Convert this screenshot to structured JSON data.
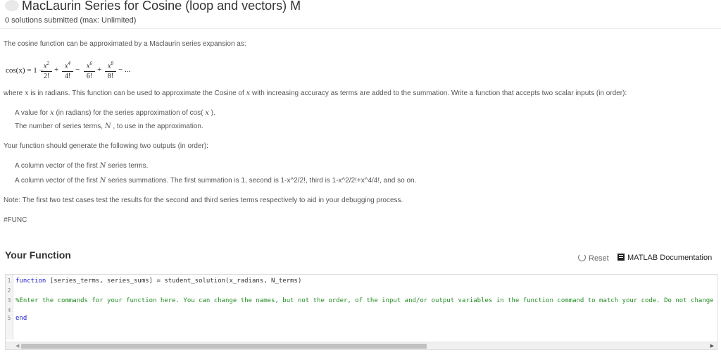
{
  "header": {
    "title": "MacLaurin Series for Cosine (loop and vectors) M",
    "subtitle": "0 solutions submitted (max: Unlimited)"
  },
  "description": {
    "intro": "The cosine function can be approximated by a Maclaurin series expansion as:",
    "formula": {
      "lhs": "cos(x) = 1 −",
      "terms": [
        {
          "num_base": "x",
          "num_exp": "2",
          "den": "2!",
          "op_after": "+"
        },
        {
          "num_base": "x",
          "num_exp": "4",
          "den": "4!",
          "op_after": "−"
        },
        {
          "num_base": "x",
          "num_exp": "6",
          "den": "6!",
          "op_after": "+"
        },
        {
          "num_base": "x",
          "num_exp": "8",
          "den": "8!",
          "op_after": "− ..."
        }
      ]
    },
    "where_pre": "where ",
    "where_var1": "x",
    "where_mid": " is in radians. This function can be used to approximate the Cosine of ",
    "where_var2": "x",
    "where_post": " with increasing accuracy as terms are added to the summation. Write a function that accepts two scalar inputs (in order):",
    "input1_pre": "A value for ",
    "input1_var": "x",
    "input1_mid": " (in radians) for the series approximation of cos( ",
    "input1_var2": "x",
    "input1_post": " ).",
    "input2_pre": "The number of series terms, ",
    "input2_var": "N",
    "input2_post": " , to use in the approximation.",
    "outputs_intro": "Your function should generate the following two outputs (in order):",
    "output1_pre": "A column vector of the first ",
    "output1_var": "N",
    "output1_post": " series terms.",
    "output2_pre": "A column vector of the first ",
    "output2_var": "N",
    "output2_post": " series summations. The first summation is 1, second is 1-x^2/2!, third is 1-x^2/2!+x^4/4!, and so on.",
    "note": "Note: The first two test cases test the results for the second and third series terms respectively to aid in your debugging process.",
    "tag": "#FUNC"
  },
  "function_section": {
    "title": "Your Function",
    "reset_label": "Reset",
    "doc_label": "MATLAB Documentation"
  },
  "editor": {
    "line_numbers": [
      "1",
      "2",
      "3",
      "4",
      "5"
    ],
    "line1_kw": "function",
    "line1_rest": " [series_terms, series_sums] = student_solution(x_radians, N_terms)",
    "line3": "%Enter the commands for your function here.  You can change the names, but not the order, of the input and/or output variables in the function command to match your code.  Do not change",
    "line5_kw": "end",
    "scroll_left_glyph": "◀",
    "scroll_right_glyph": "▶"
  }
}
